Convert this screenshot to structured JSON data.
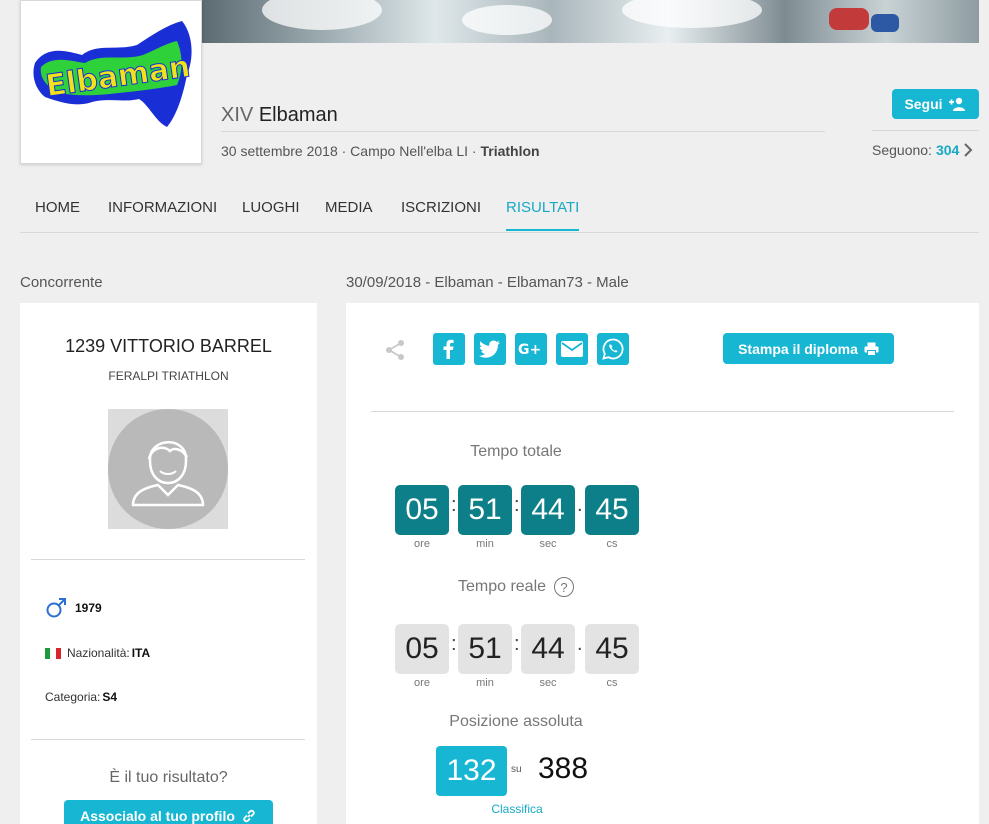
{
  "event": {
    "title_prefix": "XIV",
    "title_name": "Elbaman",
    "date_location": "30 settembre 2018 · Campo Nell'elba LI ·",
    "sport": "Triathlon",
    "logo_text": "Elbaman"
  },
  "follow": {
    "button_label": "Segui",
    "followers_label": "Seguono:",
    "followers_count": "304"
  },
  "nav": {
    "tabs": [
      "HOME",
      "INFORMAZIONI",
      "LUOGHI",
      "MEDIA",
      "ISCRIZIONI",
      "RISULTATI"
    ],
    "active": "RISULTATI"
  },
  "left": {
    "section_label": "Concorrente",
    "athlete_name": "1239 VITTORIO BARREL",
    "team": "FERALPI TRIATHLON",
    "birth_year": "1979",
    "nationality_label": "Nazionalità:",
    "nationality": "ITA",
    "category_label": "Categoria:",
    "category": "S4",
    "question": "È il tuo risultato?",
    "associate_button": "Associalo al tuo profilo"
  },
  "right": {
    "section_label": "30/09/2018 - Elbaman - Elbaman73 - Male",
    "print_button": "Stampa il diploma",
    "social": [
      "facebook-icon",
      "twitter-icon",
      "google-plus-icon",
      "email-icon",
      "whatsapp-icon"
    ],
    "total_time": {
      "label": "Tempo totale",
      "values": [
        "05",
        "51",
        "44",
        "45"
      ],
      "units": [
        "ore",
        "min",
        "sec",
        "cs"
      ]
    },
    "real_time": {
      "label": "Tempo reale",
      "help": "?",
      "values": [
        "05",
        "51",
        "44",
        "45"
      ],
      "units": [
        "ore",
        "min",
        "sec",
        "cs"
      ]
    },
    "position": {
      "label": "Posizione assoluta",
      "rank": "132",
      "su": "su",
      "total": "388",
      "link": "Classifica"
    }
  },
  "colors": {
    "accent": "#17b7d4",
    "timer_dark": "#0d7f88",
    "timer_light": "#e3e3e3",
    "background": "#efefef"
  }
}
